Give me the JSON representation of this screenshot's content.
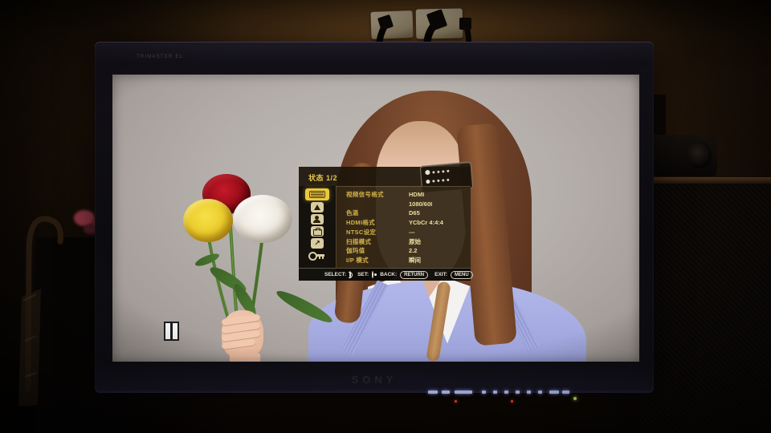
{
  "scene": {
    "monitor_brand": "SONY",
    "monitor_tagline": "TRIMASTER EL"
  },
  "osd": {
    "title": "状态 1/2",
    "rows": [
      {
        "label": "视频信号格式",
        "value": "HDMI"
      },
      {
        "label": "",
        "value": "1080/60I"
      },
      {
        "label": "色温",
        "value": "D65"
      },
      {
        "label": "HDMI格式",
        "value": "YCbCr 4:4:4"
      },
      {
        "label": "NTSC设定",
        "value": "---"
      },
      {
        "label": "扫描模式",
        "value": "原始"
      },
      {
        "label": "伽玛值",
        "value": "2.2"
      },
      {
        "label": "I/P 模式",
        "value": "瞬间"
      }
    ],
    "sidebar_icons": [
      "status-list",
      "color-temp",
      "user-profile",
      "toolbox",
      "remote-arrow",
      "key-lock"
    ],
    "footer": {
      "select_label": "SELECT:",
      "set_label": "SET:",
      "back_label": "BACK:",
      "back_button": "RETURN",
      "exit_label": "EXIT:",
      "exit_button": "MENU"
    },
    "colors": {
      "accent": "#e8c74a",
      "label_text": "#d3b24b",
      "value_text": "#ecdf9f",
      "panel": "#2d2313"
    }
  }
}
